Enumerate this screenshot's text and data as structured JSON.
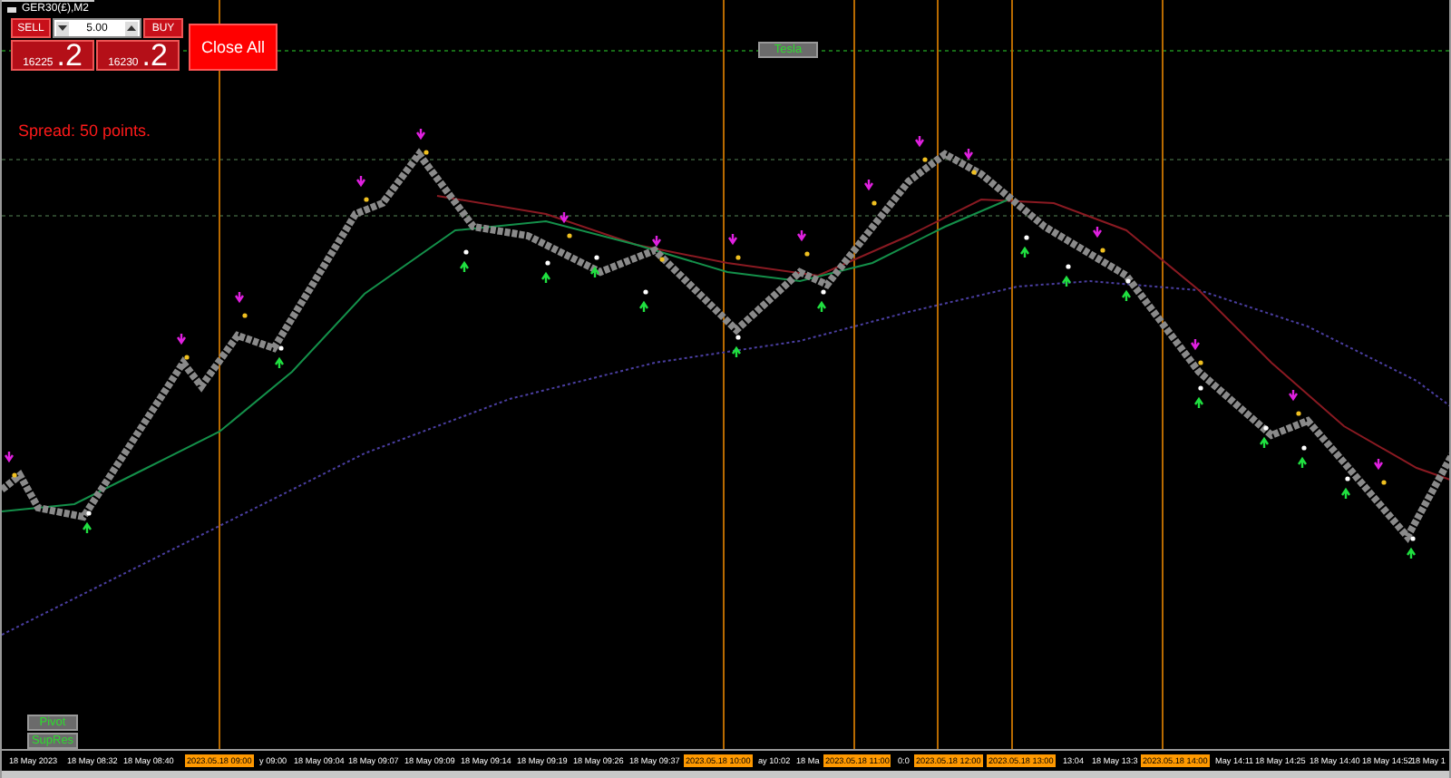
{
  "window": {
    "title": "GER30(£),M2"
  },
  "trade_panel": {
    "sell_label": "SELL",
    "buy_label": "BUY",
    "lot": "5.00",
    "sell_price": {
      "main": "16225",
      "pips": ".2"
    },
    "buy_price": {
      "main": "16230",
      "pips": ".2"
    },
    "close_all": "Close All"
  },
  "spread": "Spread: 50 points.",
  "chart_button": "Tesla",
  "bottom_buttons": [
    "Pivot",
    "SupRes"
  ],
  "time_axis": [
    {
      "label": "18 May 2023",
      "kind": "date"
    },
    {
      "label": "18 May 08:32",
      "kind": "date"
    },
    {
      "label": "18 May 08:40",
      "kind": "date"
    },
    {
      "label": "2023.05.18 09:00",
      "kind": "marker"
    },
    {
      "label": "y 09:00",
      "kind": "date"
    },
    {
      "label": "18 May 09:04",
      "kind": "date"
    },
    {
      "label": "18 May 09:07",
      "kind": "date"
    },
    {
      "label": "18 May 09:09",
      "kind": "date"
    },
    {
      "label": "18 May 09:14",
      "kind": "date"
    },
    {
      "label": "18 May 09:19",
      "kind": "date"
    },
    {
      "label": "18 May 09:26",
      "kind": "date"
    },
    {
      "label": "18 May 09:37",
      "kind": "date"
    },
    {
      "label": "2023.05.18 10:00",
      "kind": "marker"
    },
    {
      "label": "ay 10:02",
      "kind": "date"
    },
    {
      "label": "18 Ma",
      "kind": "date"
    },
    {
      "label": "2023.05.18 11:00",
      "kind": "marker"
    },
    {
      "label": "0:0",
      "kind": "date"
    },
    {
      "label": "2023.05.18 12:00",
      "kind": "marker"
    },
    {
      "label": "2023.05.18 13:00",
      "kind": "marker"
    },
    {
      "label": "13:04",
      "kind": "date"
    },
    {
      "label": "18 May 13:3",
      "kind": "date"
    },
    {
      "label": "2023.05.18 14:00",
      "kind": "marker"
    },
    {
      "label": "May 14:11",
      "kind": "date"
    },
    {
      "label": "18 May 14:25",
      "kind": "date"
    },
    {
      "label": "18 May 14:40",
      "kind": "date"
    },
    {
      "label": "18 May 14:52",
      "kind": "date"
    },
    {
      "label": "18 May 1",
      "kind": "date"
    }
  ]
}
